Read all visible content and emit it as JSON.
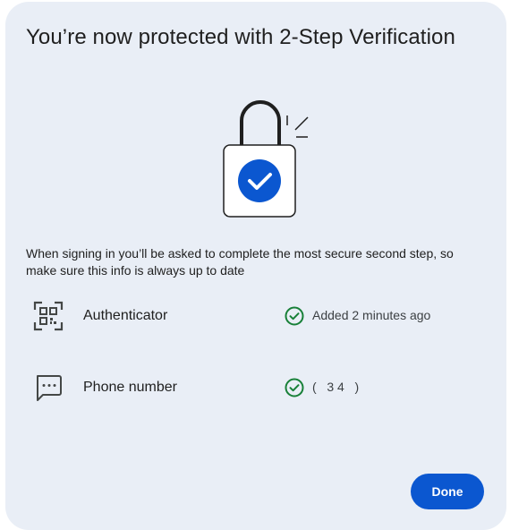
{
  "dialog": {
    "title": "You’re now protected with 2-Step Verification",
    "intro": "When signing in you’ll be asked to complete the most secure second step, so make sure this info is always up to date",
    "illustration": "lock-check-icon",
    "methods": [
      {
        "name": "Authenticator",
        "icon": "qr-code-icon",
        "status_icon": "check-circle-icon",
        "status": "Added 2 minutes ago"
      },
      {
        "name": "Phone number",
        "icon": "sms-icon",
        "status_icon": "check-circle-icon",
        "status": "(   3 4   )"
      }
    ],
    "done_label": "Done"
  },
  "colors": {
    "dialog_bg": "#e9eef6",
    "accent": "#0b57d0",
    "success": "#188038",
    "text": "#1f1f1f"
  }
}
